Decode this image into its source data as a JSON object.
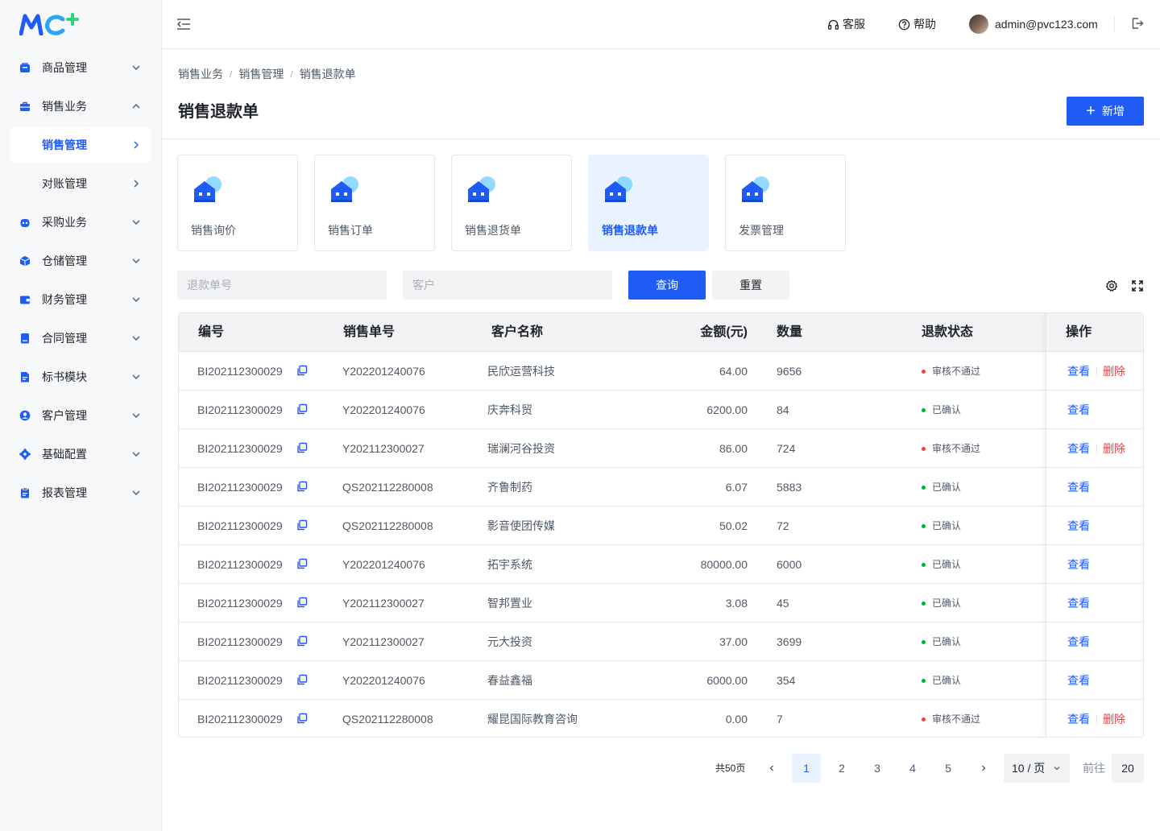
{
  "colors": {
    "primary": "#1f5cf6",
    "danger": "#f53f3f",
    "success": "#00b42a",
    "accent_green": "#33d17a"
  },
  "logo": {
    "text": "MC+"
  },
  "sidebar": {
    "items": [
      {
        "label": "商品管理",
        "icon": "goods-icon",
        "arrow": "down"
      },
      {
        "label": "销售业务",
        "icon": "briefcase-icon",
        "arrow": "up"
      },
      {
        "label": "销售管理",
        "sub": true,
        "active": true,
        "arrow": "right"
      },
      {
        "label": "对账管理",
        "sub": true,
        "arrow": "right"
      },
      {
        "label": "采购业务",
        "icon": "robot-icon",
        "arrow": "down"
      },
      {
        "label": "仓储管理",
        "icon": "cube-icon",
        "arrow": "down"
      },
      {
        "label": "财务管理",
        "icon": "wallet-icon",
        "arrow": "down"
      },
      {
        "label": "合同管理",
        "icon": "contract-icon",
        "arrow": "down"
      },
      {
        "label": "标书模块",
        "icon": "document-icon",
        "arrow": "down"
      },
      {
        "label": "客户管理",
        "icon": "user-icon",
        "arrow": "down"
      },
      {
        "label": "基础配置",
        "icon": "gear-icon",
        "arrow": "down"
      },
      {
        "label": "报表管理",
        "icon": "clipboard-icon",
        "arrow": "down"
      }
    ]
  },
  "header": {
    "service_label": "客服",
    "help_label": "帮助",
    "user_email": "admin@pvc123.com"
  },
  "breadcrumb": [
    "销售业务",
    "销售管理",
    "销售退款单"
  ],
  "page": {
    "title": "销售退款单",
    "add_label": "新增"
  },
  "cards": [
    {
      "label": "销售询价"
    },
    {
      "label": "销售订单"
    },
    {
      "label": "销售退货单"
    },
    {
      "label": "销售退款单",
      "active": true
    },
    {
      "label": "发票管理"
    }
  ],
  "filters": {
    "refund_no_placeholder": "退款单号",
    "customer_placeholder": "客户",
    "query_label": "查询",
    "reset_label": "重置"
  },
  "table": {
    "columns": [
      "编号",
      "销售单号",
      "客户名称",
      "金额(元)",
      "数量",
      "退款状态",
      "操作"
    ],
    "view_label": "查看",
    "delete_label": "删除",
    "rows": [
      {
        "id": "BI202112300029",
        "order_no": "Y202201240076",
        "customer": "民欣运营科技",
        "amount": "64.00",
        "qty": "9656",
        "status": "审核不通过",
        "status_type": "rejected"
      },
      {
        "id": "BI202112300029",
        "order_no": "Y202201240076",
        "customer": "庆奔科贸",
        "amount": "6200.00",
        "qty": "84",
        "status": "已确认",
        "status_type": "confirmed"
      },
      {
        "id": "BI202112300029",
        "order_no": "Y202112300027",
        "customer": "瑞澜河谷投资",
        "amount": "86.00",
        "qty": "724",
        "status": "审核不通过",
        "status_type": "rejected"
      },
      {
        "id": "BI202112300029",
        "order_no": "QS202112280008",
        "customer": "齐鲁制药",
        "amount": "6.07",
        "qty": "5883",
        "status": "已确认",
        "status_type": "confirmed"
      },
      {
        "id": "BI202112300029",
        "order_no": "QS202112280008",
        "customer": "影音使团传媒",
        "amount": "50.02",
        "qty": "72",
        "status": "已确认",
        "status_type": "confirmed"
      },
      {
        "id": "BI202112300029",
        "order_no": "Y202201240076",
        "customer": "拓宇系统",
        "amount": "80000.00",
        "qty": "6000",
        "status": "已确认",
        "status_type": "confirmed"
      },
      {
        "id": "BI202112300029",
        "order_no": "Y202112300027",
        "customer": "智邦置业",
        "amount": "3.08",
        "qty": "45",
        "status": "已确认",
        "status_type": "confirmed"
      },
      {
        "id": "BI202112300029",
        "order_no": "Y202112300027",
        "customer": "元大投资",
        "amount": "37.00",
        "qty": "3699",
        "status": "已确认",
        "status_type": "confirmed"
      },
      {
        "id": "BI202112300029",
        "order_no": "Y202201240076",
        "customer": "春益鑫福",
        "amount": "6000.00",
        "qty": "354",
        "status": "已确认",
        "status_type": "confirmed"
      },
      {
        "id": "BI202112300029",
        "order_no": "QS202112280008",
        "customer": "耀昆国际教育咨询",
        "amount": "0.00",
        "qty": "7",
        "status": "审核不通过",
        "status_type": "rejected"
      }
    ]
  },
  "pagination": {
    "total_label": "共50页",
    "pages": [
      "1",
      "2",
      "3",
      "4",
      "5"
    ],
    "current": "1",
    "page_size": "10 / 页",
    "goto_label": "前往",
    "goto_value": "20"
  }
}
